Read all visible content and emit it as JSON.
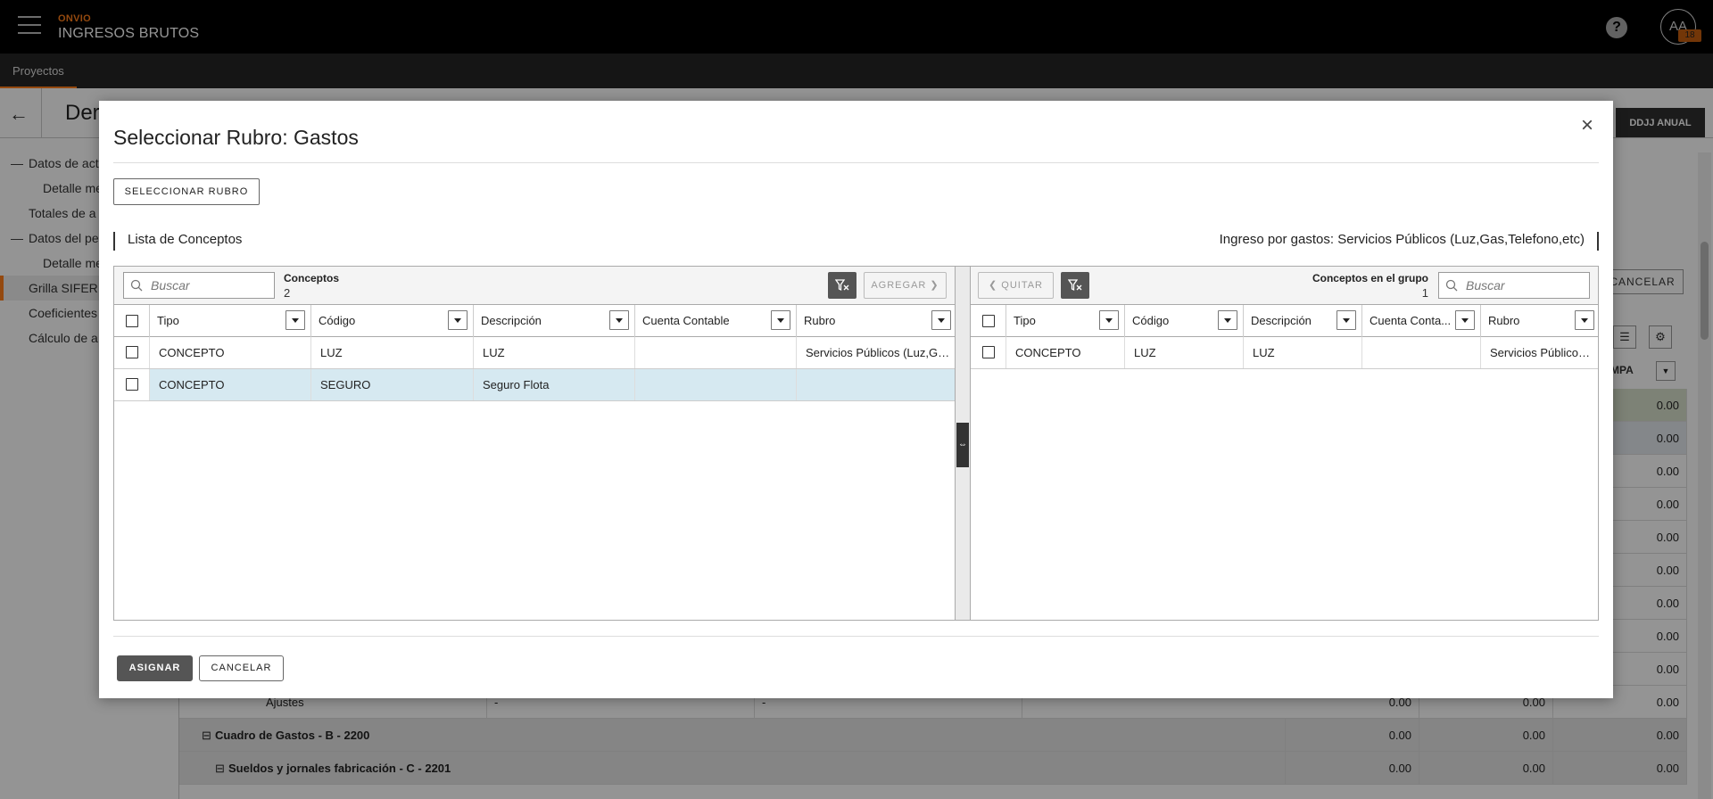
{
  "app": {
    "brand": "ONVIO",
    "title": "INGRESOS BRUTOS",
    "avatar_initials": "AA",
    "avatar_badge": "18",
    "help_icon": "question-circle-icon",
    "accent_color": "#ff7f1a"
  },
  "nav": {
    "tabs": [
      {
        "label": "Proyectos",
        "active": true
      }
    ]
  },
  "page": {
    "title": "Der",
    "ddjj_button": "DDJJ ANUAL",
    "cancel_button": "CANCELAR",
    "column_header": "MPA",
    "sidebar": [
      {
        "label": "Datos de act",
        "prefix": "—"
      },
      {
        "label": "Detalle me",
        "indent": true
      },
      {
        "label": "Totales de a"
      },
      {
        "label": "Datos del pe",
        "prefix": "—"
      },
      {
        "label": "Detalle me",
        "indent": true
      },
      {
        "label": "Grilla SIFER",
        "active": true
      },
      {
        "label": "Coeficientes"
      },
      {
        "label": "Cálculo de a"
      }
    ],
    "grid_values": [
      "0.00",
      "0.00",
      "0.00",
      "0.00",
      "0.00",
      "0.00",
      "0.00",
      "0.00",
      "0.00"
    ],
    "bottom_rows": [
      {
        "label": "Ajustes",
        "col2": "-",
        "col3": "-",
        "v1": "0.00",
        "v2": "0.00",
        "v3": "0.00"
      },
      {
        "label": "Cuadro de Gastos - B - 2200",
        "v1": "0.00",
        "v2": "0.00",
        "v3": "0.00"
      },
      {
        "label": "Sueldos y jornales fabricación - C - 2201",
        "v1": "0.00",
        "v2": "0.00",
        "v3": "0.00"
      }
    ]
  },
  "modal": {
    "title": "Seleccionar Rubro: Gastos",
    "select_button": "SELECCIONAR RUBRO",
    "left_section_label": "Lista de Conceptos",
    "right_section_label": "Ingreso por gastos: Servicios Públicos (Luz,Gas,Telefono,etc)",
    "assign_button": "ASIGNAR",
    "cancel_button": "CANCELAR",
    "left": {
      "search_placeholder": "Buscar",
      "title": "Conceptos",
      "count": "2",
      "add_button": "AGREGAR ❯",
      "columns": [
        "Tipo",
        "Código",
        "Descripción",
        "Cuenta Contable",
        "Rubro"
      ],
      "rows": [
        {
          "tipo": "CONCEPTO",
          "codigo": "LUZ",
          "descripcion": "LUZ",
          "cuenta": "",
          "rubro": "Servicios Públicos (Luz,Gas,Telefono,etc)",
          "selected": false
        },
        {
          "tipo": "CONCEPTO",
          "codigo": "SEGURO",
          "descripcion": "Seguro Flota",
          "cuenta": "",
          "rubro": "",
          "selected": true
        }
      ]
    },
    "right": {
      "remove_button": "❮ QUITAR",
      "title": "Conceptos en el grupo",
      "count": "1",
      "search_placeholder": "Buscar",
      "columns": [
        "Tipo",
        "Código",
        "Descripción",
        "Cuenta Conta...",
        "Rubro"
      ],
      "rows": [
        {
          "tipo": "CONCEPTO",
          "codigo": "LUZ",
          "descripcion": "LUZ",
          "cuenta": "",
          "rubro": "Servicios Públicos (Luz,Gas,Telefono,etc)"
        }
      ]
    }
  }
}
